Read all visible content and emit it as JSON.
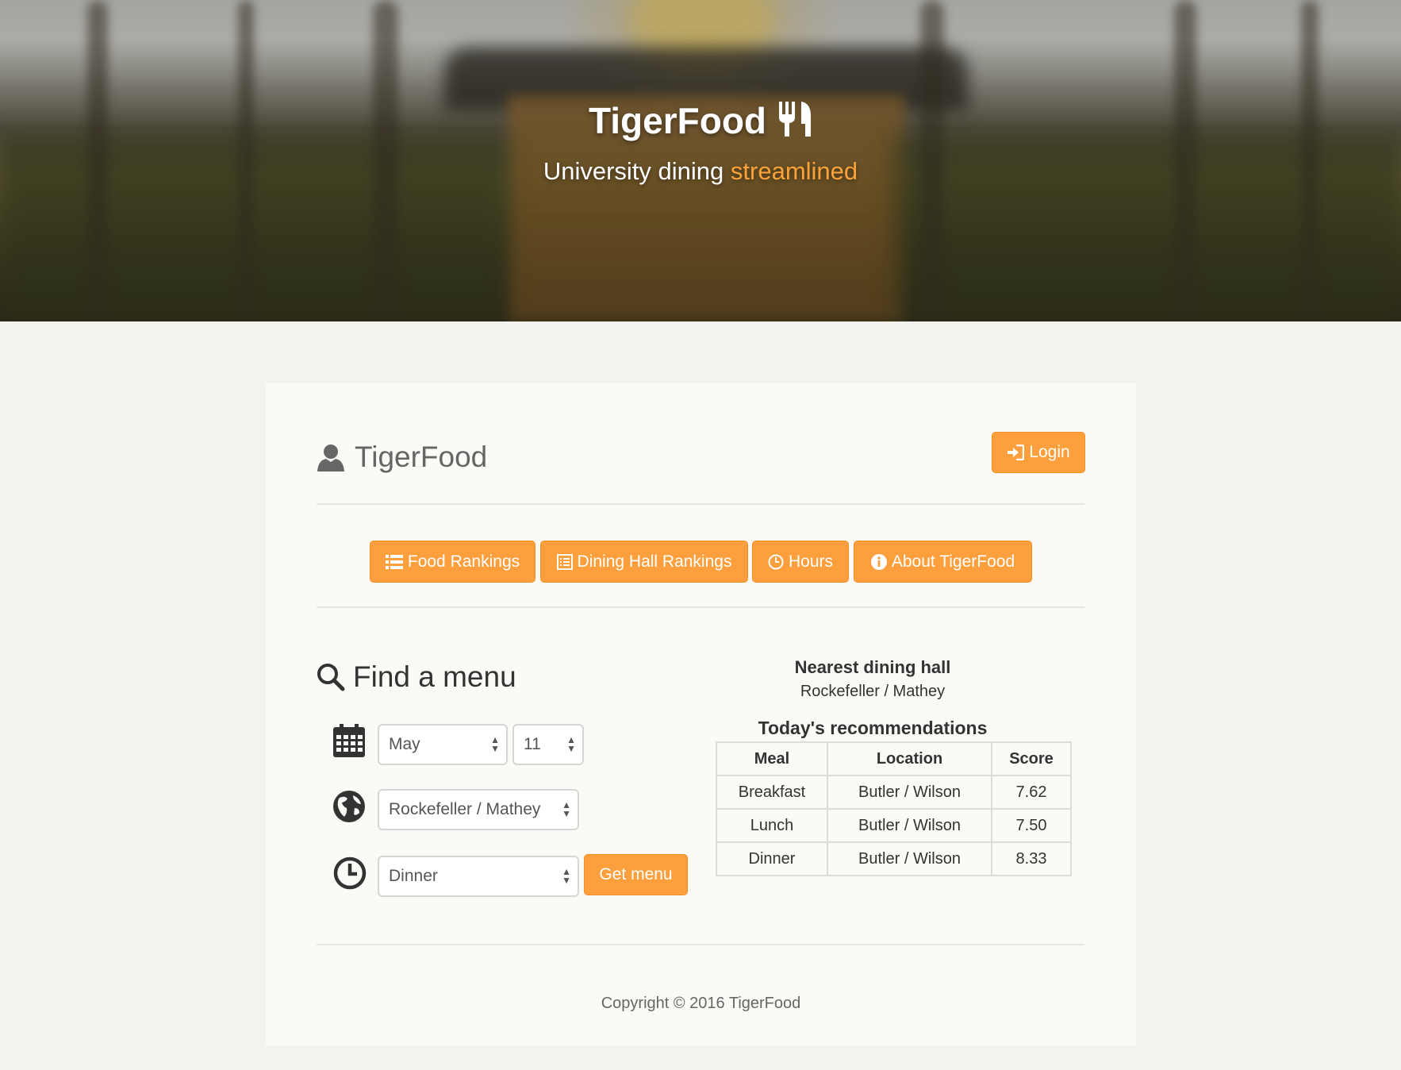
{
  "hero": {
    "title": "TigerFood",
    "subtitle_plain": "University dining",
    "subtitle_accent": "streamlined",
    "icon": "fork-knife-icon"
  },
  "header": {
    "brand": "TigerFood",
    "brand_icon": "user-icon",
    "login_label": "Login",
    "login_icon": "login-icon"
  },
  "nav": {
    "items": [
      {
        "label": "Food Rankings",
        "icon": "list-icon"
      },
      {
        "label": "Dining Hall Rankings",
        "icon": "list-alt-icon"
      },
      {
        "label": "Hours",
        "icon": "clock-icon"
      },
      {
        "label": "About TigerFood",
        "icon": "info-icon"
      }
    ]
  },
  "find": {
    "title": "Find a menu",
    "title_icon": "search-icon",
    "month": "May",
    "day": "11",
    "location": "Rockefeller / Mathey",
    "meal": "Dinner",
    "get_menu_label": "Get menu"
  },
  "nearest": {
    "title": "Nearest dining hall",
    "value": "Rockefeller / Mathey"
  },
  "recommendations": {
    "title": "Today's recommendations",
    "columns": [
      "Meal",
      "Location",
      "Score"
    ],
    "rows": [
      [
        "Breakfast",
        "Butler / Wilson",
        "7.62"
      ],
      [
        "Lunch",
        "Butler / Wilson",
        "7.50"
      ],
      [
        "Dinner",
        "Butler / Wilson",
        "8.33"
      ]
    ]
  },
  "footer": {
    "text": "Copyright © 2016 TigerFood"
  },
  "colors": {
    "accent": "#fd9f3c",
    "page_bg": "#f3f2ee",
    "card_bg": "#fbfaf7"
  }
}
